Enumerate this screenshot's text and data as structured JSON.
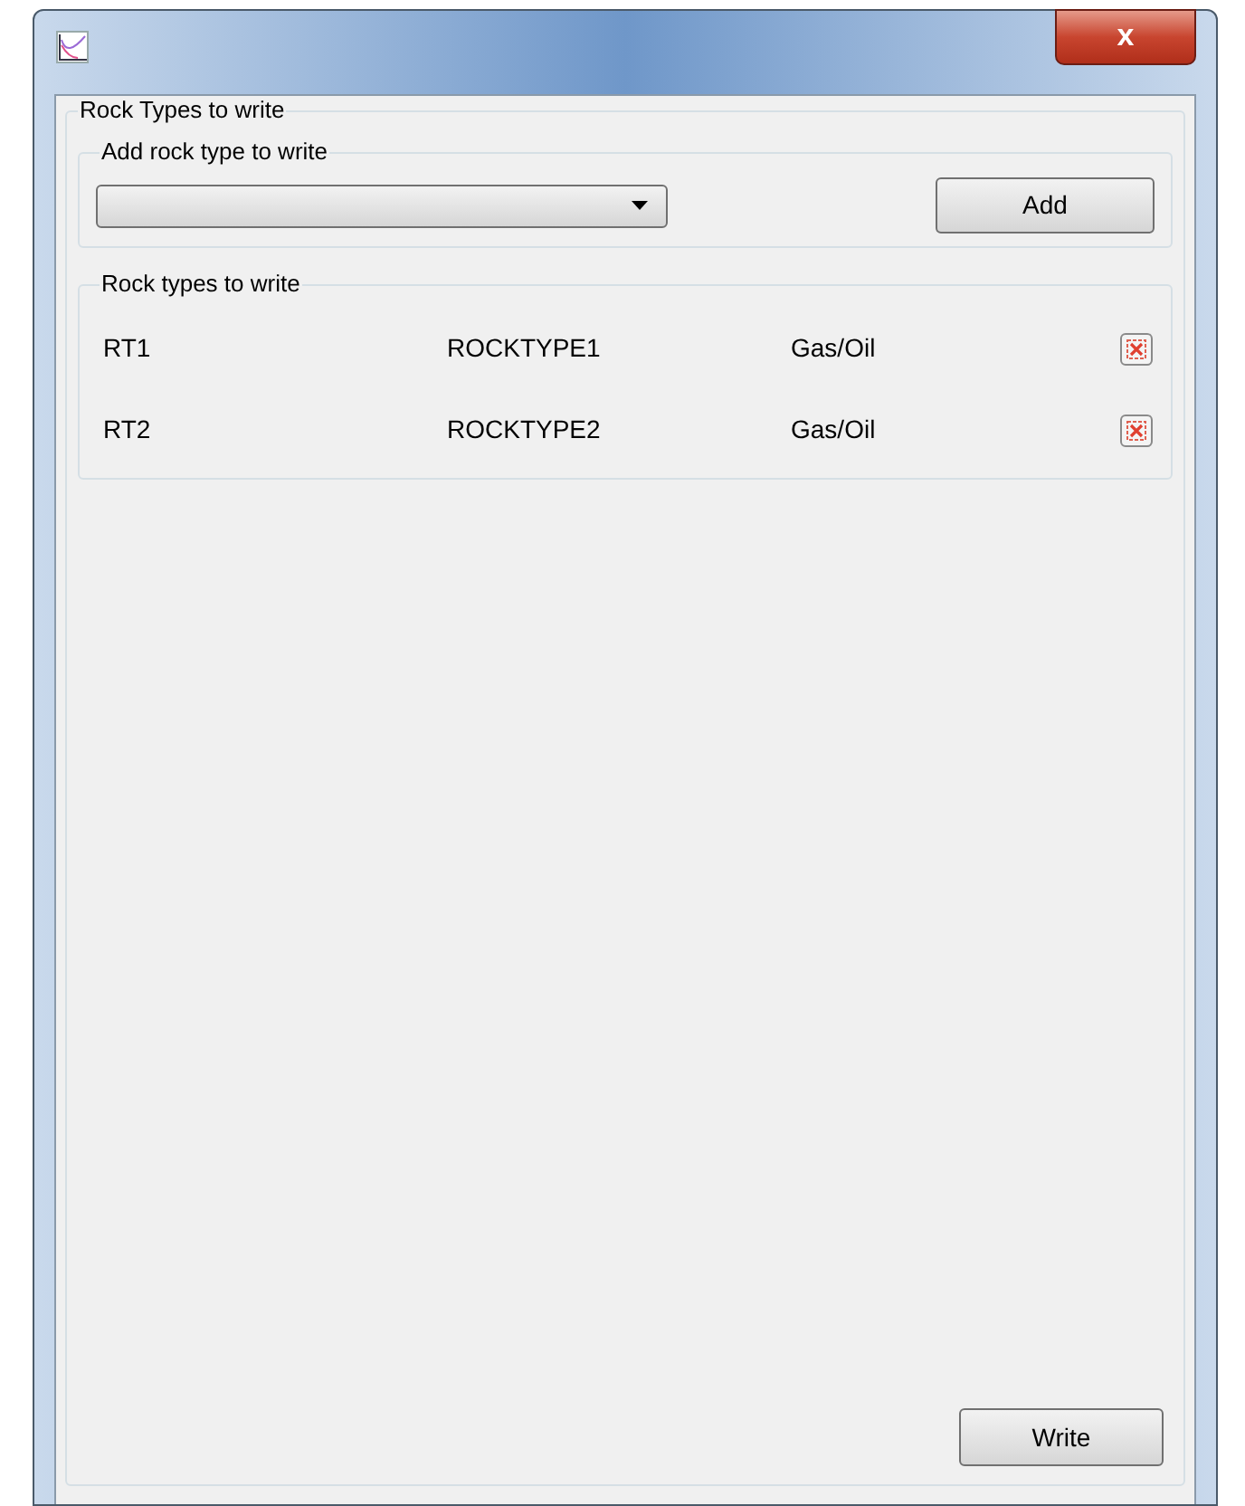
{
  "window": {
    "close_label": "x"
  },
  "group": {
    "title": "Rock Types to write"
  },
  "add_section": {
    "title": "Add rock type to write",
    "add_button": "Add"
  },
  "list_section": {
    "title": "Rock types to write",
    "rows": [
      {
        "id": "RT1",
        "name": "ROCKTYPE1",
        "phase": "Gas/Oil"
      },
      {
        "id": "RT2",
        "name": "ROCKTYPE2",
        "phase": "Gas/Oil"
      }
    ]
  },
  "write_button": "Write"
}
